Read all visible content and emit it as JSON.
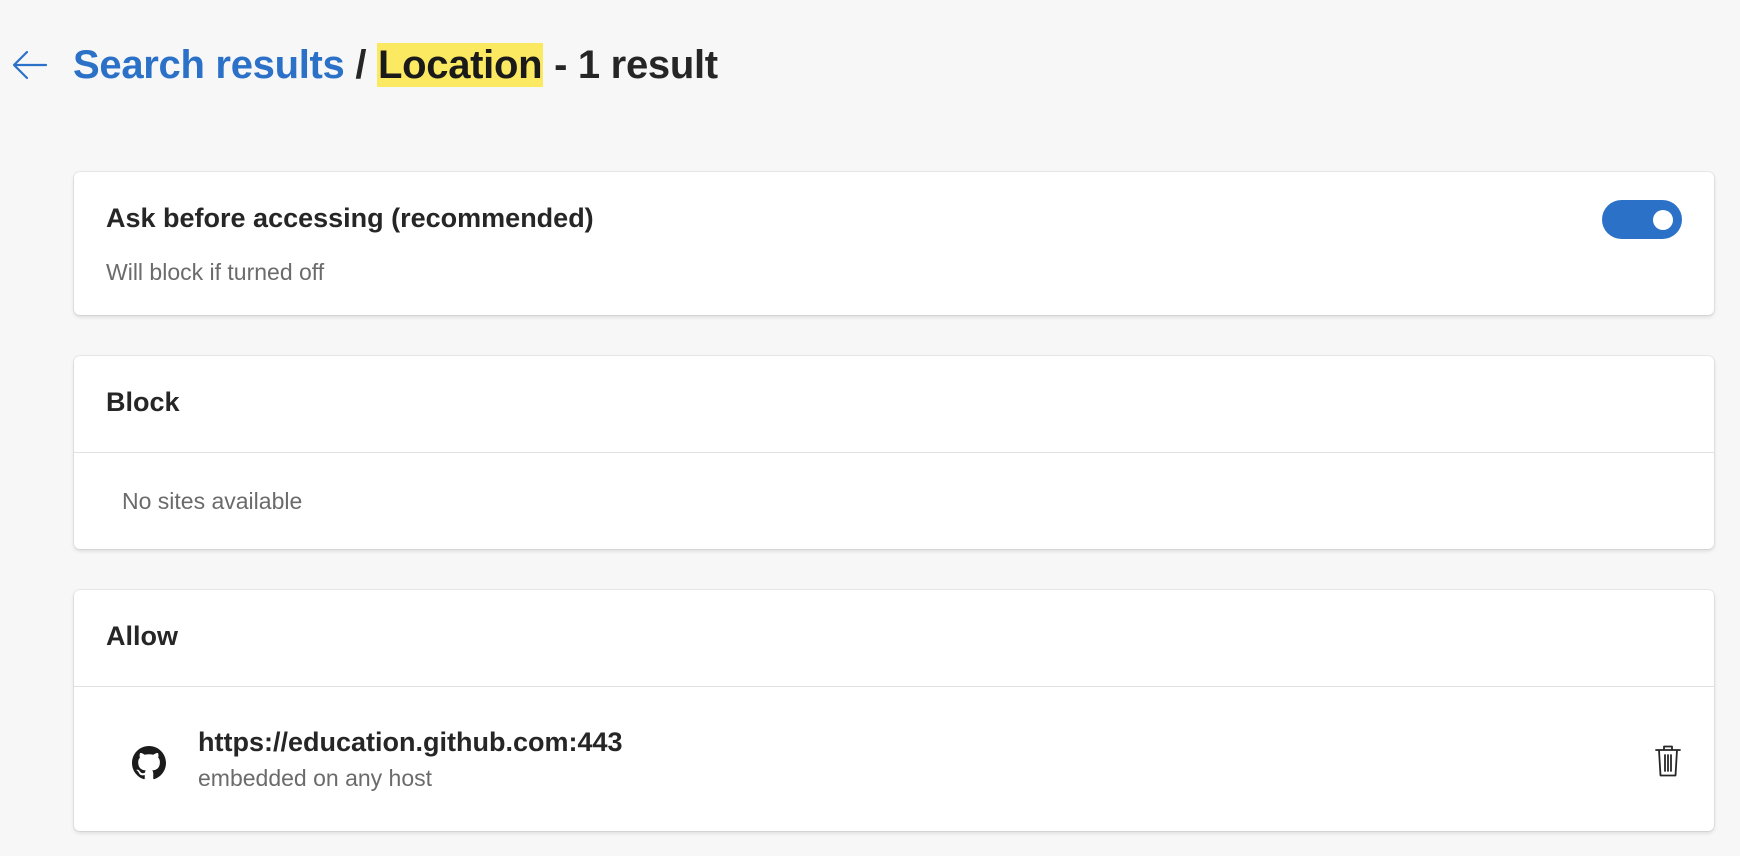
{
  "header": {
    "back_icon": "arrow-left-icon",
    "breadcrumb_link": "Search results",
    "separator": "/",
    "search_term": "Location",
    "result_suffix": "- 1 result"
  },
  "ask_setting": {
    "title": "Ask before accessing (recommended)",
    "subtitle": "Will block if turned off",
    "toggle_on": true
  },
  "block_section": {
    "title": "Block",
    "empty_text": "No sites available"
  },
  "allow_section": {
    "title": "Allow",
    "sites": [
      {
        "icon": "github-icon",
        "url": "https://education.github.com:443",
        "description": "embedded on any host",
        "delete_icon": "trash-icon"
      }
    ]
  },
  "colors": {
    "accent": "#2b71c8",
    "highlight": "#fbe961",
    "background": "#f7f7f7"
  }
}
